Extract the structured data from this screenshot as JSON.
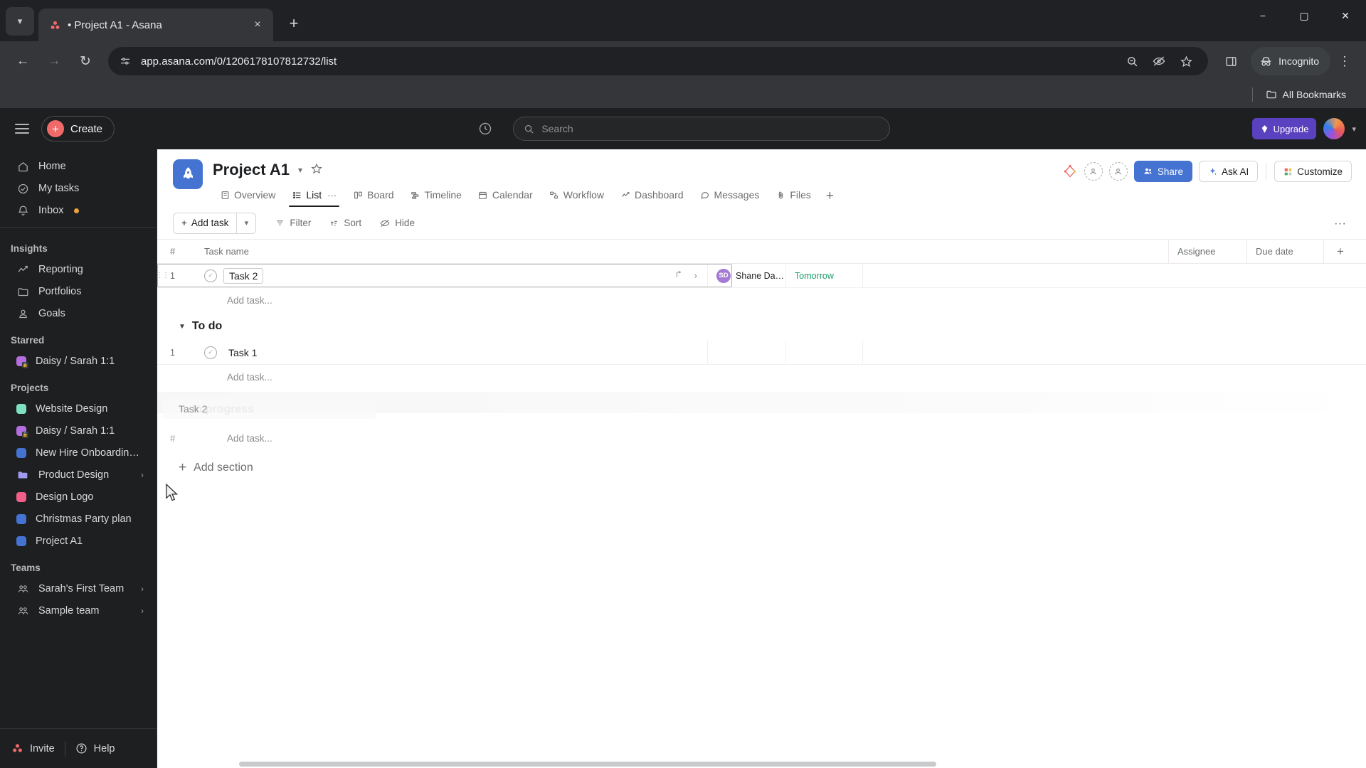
{
  "browser": {
    "tab": {
      "title": "• Project A1 - Asana",
      "favicon": "asana-icon",
      "close_label": "×"
    },
    "new_tab_label": "+",
    "tab_list_icon": "chevron-down-icon",
    "window": {
      "minimize": "−",
      "maximize": "▢",
      "close": "✕"
    },
    "url": "app.asana.com/0/1206178107812732/list",
    "omnibox_icon": "site-settings-icon",
    "actions": [
      "zoom-out-icon",
      "hide-password-icon",
      "bookmark-star-icon"
    ],
    "side_panel_icon": "side-panel-icon",
    "incognito_label": "Incognito",
    "menu_icon": "kebab-menu-icon",
    "bookmarks_label": "All Bookmarks"
  },
  "asana_top": {
    "menu_icon": "hamburger-icon",
    "create_label": "Create",
    "clock_icon": "recent-clock-icon",
    "search_placeholder": "Search",
    "upgrade_label": "Upgrade",
    "avatar": "user-avatar"
  },
  "sidebar": {
    "primary": [
      {
        "label": "Home",
        "icon": "home-icon"
      },
      {
        "label": "My tasks",
        "icon": "check-circle-icon"
      },
      {
        "label": "Inbox",
        "icon": "bell-icon",
        "badge": true
      }
    ],
    "insights_header": "Insights",
    "insights": [
      {
        "label": "Reporting",
        "icon": "reporting-chart-icon"
      },
      {
        "label": "Portfolios",
        "icon": "folder-icon"
      },
      {
        "label": "Goals",
        "icon": "goal-person-icon"
      }
    ],
    "starred_header": "Starred",
    "starred": [
      {
        "label": "Daisy / Sarah 1:1",
        "color": "#b36fe0",
        "locked": true
      }
    ],
    "projects_header": "Projects",
    "projects": [
      {
        "label": "Website Design",
        "color": "#7ee0c0",
        "locked": false,
        "shape": "square"
      },
      {
        "label": "Daisy / Sarah 1:1",
        "color": "#b36fe0",
        "locked": true,
        "shape": "square"
      },
      {
        "label": "New Hire Onboarding Ch...",
        "color": "#4573d2",
        "locked": false,
        "shape": "square"
      },
      {
        "label": "Product Design",
        "color": "#9d9aef",
        "locked": false,
        "shape": "folder",
        "chevron": "›"
      },
      {
        "label": "Design Logo",
        "color": "#ef5f87",
        "locked": false,
        "shape": "square"
      },
      {
        "label": "Christmas Party plan",
        "color": "#4573d2",
        "locked": false,
        "shape": "square"
      },
      {
        "label": "Project A1",
        "color": "#4573d2",
        "locked": false,
        "shape": "square"
      }
    ],
    "teams_header": "Teams",
    "teams": [
      {
        "label": "Sarah's First Team",
        "icon": "team-icon",
        "chevron": "›"
      },
      {
        "label": "Sample team",
        "icon": "team-icon",
        "chevron": "›"
      }
    ],
    "footer": {
      "invite": "Invite",
      "help": "Help"
    }
  },
  "project": {
    "title": "Project A1",
    "icon": "rocket-icon",
    "caret": "chevron-down-icon",
    "star": "star-outline-icon",
    "tabs": [
      {
        "label": "Overview",
        "icon": "overview-icon",
        "active": false
      },
      {
        "label": "List",
        "icon": "list-icon",
        "active": true,
        "has_dots": true
      },
      {
        "label": "Board",
        "icon": "board-icon",
        "active": false
      },
      {
        "label": "Timeline",
        "icon": "timeline-icon",
        "active": false
      },
      {
        "label": "Calendar",
        "icon": "calendar-icon",
        "active": false
      },
      {
        "label": "Workflow",
        "icon": "workflow-icon",
        "active": false
      },
      {
        "label": "Dashboard",
        "icon": "dashboard-icon",
        "active": false
      },
      {
        "label": "Messages",
        "icon": "messages-icon",
        "active": false
      },
      {
        "label": "Files",
        "icon": "files-icon",
        "active": false
      }
    ],
    "tab_add": "+",
    "header_actions": {
      "share": "Share",
      "ask_ai": "Ask AI",
      "customize": "Customize"
    }
  },
  "toolbar": {
    "add_task": "Add task",
    "add_task_caret": "chevron-down-icon",
    "filter": "Filter",
    "sort": "Sort",
    "hide": "Hide",
    "more": "···"
  },
  "table": {
    "columns": {
      "hash": "#",
      "task_name": "Task name",
      "assignee": "Assignee",
      "due_date": "Due date",
      "add_column": "+"
    },
    "top_rows": [
      {
        "num": "1",
        "name": "Task 2",
        "selected": true,
        "assignee_initials": "SD",
        "assignee": "Shane Daws...",
        "due": "Tomorrow",
        "subtask_icon": "subtask-icon",
        "expand_icon": "chevron-right-icon"
      }
    ],
    "top_add_task": "Add task...",
    "sections": [
      {
        "name": "To do",
        "caret": "caret-down-icon",
        "rows": [
          {
            "num": "1",
            "name": "Task 1",
            "assignee_initials": "",
            "assignee": "",
            "due": ""
          }
        ],
        "add_task": "Add task..."
      }
    ],
    "drag": {
      "chip_label": "Task 2",
      "ghost_section": "In progress",
      "ghost_caret": "caret-down-icon"
    },
    "bottom_hash": "#",
    "bottom_add_task": "Add task...",
    "add_section": "Add section",
    "add_section_plus": "+"
  }
}
